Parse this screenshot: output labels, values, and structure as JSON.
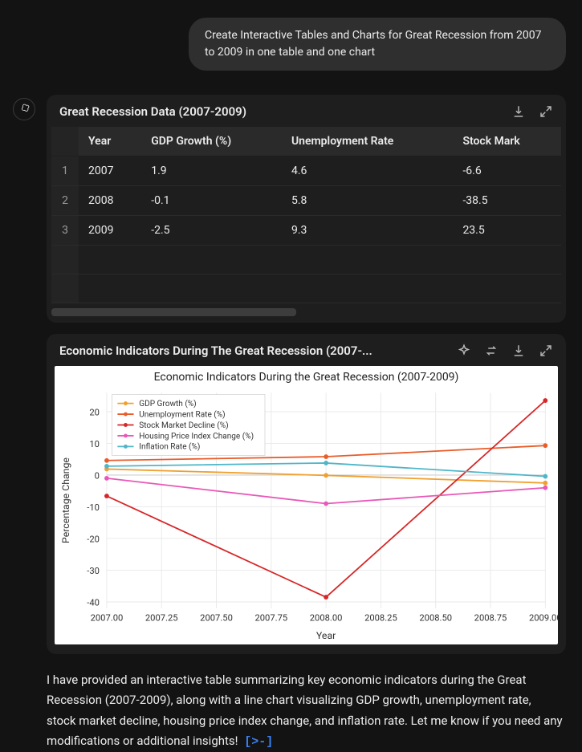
{
  "user_prompt": "Create Interactive Tables and Charts for Great Recession from 2007 to 2009 in one table and one chart",
  "table": {
    "title": "Great Recession Data (2007-2009)",
    "columns": [
      "Year",
      "GDP Growth (%)",
      "Unemployment Rate",
      "Stock Mark"
    ],
    "rows": [
      {
        "idx": "1",
        "cells": [
          "2007",
          "1.9",
          "4.6",
          "-6.6"
        ]
      },
      {
        "idx": "2",
        "cells": [
          "2008",
          "-0.1",
          "5.8",
          "-38.5"
        ]
      },
      {
        "idx": "3",
        "cells": [
          "2009",
          "-2.5",
          "9.3",
          "23.5"
        ]
      }
    ]
  },
  "chart_panel_title": "Economic Indicators During The Great Recession (2007-...",
  "chart_data": {
    "type": "line",
    "title": "Economic Indicators During the Great Recession (2007-2009)",
    "xlabel": "Year",
    "ylabel": "Percentage Change",
    "x": [
      2007,
      2008,
      2009
    ],
    "xticks": [
      2007.0,
      2007.25,
      2007.5,
      2007.75,
      2008.0,
      2008.25,
      2008.5,
      2008.75,
      2009.0
    ],
    "yticks": [
      -40,
      -30,
      -20,
      -10,
      0,
      10,
      20
    ],
    "ylim": [
      -42,
      26
    ],
    "series": [
      {
        "name": "GDP Growth (%)",
        "color": "#f0a030",
        "values": [
          1.9,
          -0.1,
          -2.5
        ]
      },
      {
        "name": "Unemployment Rate (%)",
        "color": "#e85d2a",
        "values": [
          4.6,
          5.8,
          9.3
        ]
      },
      {
        "name": "Stock Market Decline (%)",
        "color": "#d62728",
        "values": [
          -6.6,
          -38.5,
          23.5
        ]
      },
      {
        "name": "Housing Price Index Change (%)",
        "color": "#e858b8",
        "values": [
          -1.0,
          -9.0,
          -4.0
        ]
      },
      {
        "name": "Inflation Rate (%)",
        "color": "#4fb6c9",
        "values": [
          2.8,
          3.8,
          -0.4
        ]
      }
    ]
  },
  "assistant_text": "I have provided an interactive table summarizing key economic indicators during the Great Recession (2007-2009), along with a line chart visualizing GDP growth, unemployment rate, stock market decline, housing price index change, and inflation rate. Let me know if you need any modifications or additional insights!",
  "terminal_glyph": "[>-]"
}
